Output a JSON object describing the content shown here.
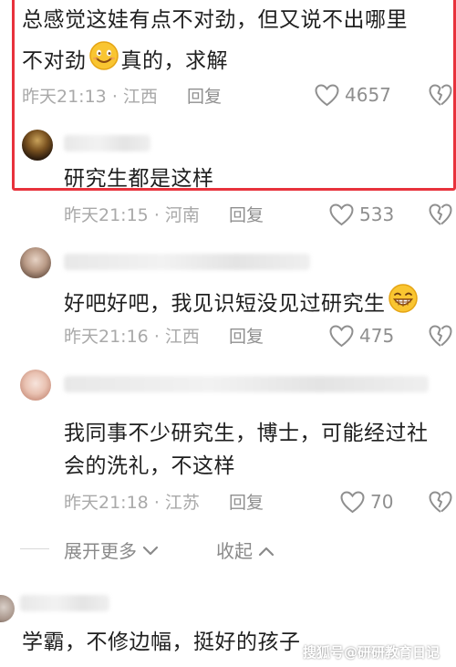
{
  "comments": [
    {
      "text_line1": "总感觉这娃有点不对劲，但又说不出哪里",
      "text_line2_a": "不对劲",
      "text_line2_b": "真的，求解",
      "time": "昨天21:13",
      "location": "江西",
      "reply_label": "回复",
      "likes": "4657",
      "emoji": "smile-emoji"
    },
    {
      "text": "研究生都是这样",
      "time": "昨天21:15",
      "location": "河南",
      "reply_label": "回复",
      "likes": "533"
    },
    {
      "text": "好吧好吧，我见识短没见过研究生",
      "time": "昨天21:16",
      "location": "江西",
      "reply_label": "回复",
      "likes": "475",
      "emoji": "grin-emoji"
    },
    {
      "text_line1": "我同事不少研究生，博士，可能经过社",
      "text_line2": "会的洗礼，不这样",
      "time": "昨天21:18",
      "location": "江苏",
      "reply_label": "回复",
      "likes": "70"
    },
    {
      "text": "学霸，不修边幅，挺好的孩子"
    }
  ],
  "separator": "·",
  "expand_label": "展开更多",
  "collapse_label": "收起",
  "watermark": "搜狐号@研研教育日记",
  "colors": {
    "highlight": "#e8323c",
    "meta": "#a9a9a9",
    "text": "#1f1f1f"
  }
}
